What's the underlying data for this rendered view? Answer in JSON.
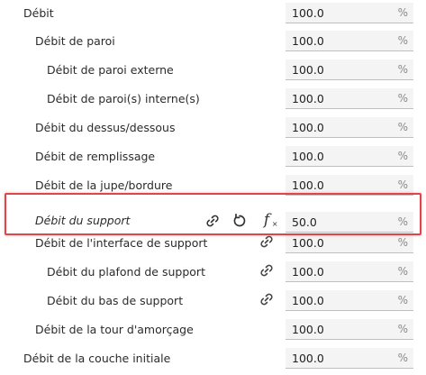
{
  "settings": [
    {
      "label": "Débit",
      "value": "100.0",
      "unit": "%"
    },
    {
      "label": "Débit de paroi",
      "value": "100.0",
      "unit": "%"
    },
    {
      "label": "Débit de paroi externe",
      "value": "100.0",
      "unit": "%"
    },
    {
      "label": "Débit de paroi(s) interne(s)",
      "value": "100.0",
      "unit": "%"
    },
    {
      "label": "Débit du dessus/dessous",
      "value": "100.0",
      "unit": "%"
    },
    {
      "label": "Débit de remplissage",
      "value": "100.0",
      "unit": "%"
    },
    {
      "label": "Débit de la jupe/bordure",
      "value": "100.0",
      "unit": "%"
    },
    {
      "label": "Débit du support",
      "value": "50.0",
      "unit": "%"
    },
    {
      "label": "Débit de l'interface de support",
      "value": "100.0",
      "unit": "%"
    },
    {
      "label": "Débit du plafond de support",
      "value": "100.0",
      "unit": "%"
    },
    {
      "label": "Débit du bas de support",
      "value": "100.0",
      "unit": "%"
    },
    {
      "label": "Débit de la tour d'amorçage",
      "value": "100.0",
      "unit": "%"
    },
    {
      "label": "Débit de la couche initiale",
      "value": "100.0",
      "unit": "%"
    }
  ],
  "icons": {
    "link": "link-icon",
    "reset": "reset-icon",
    "formula": "formula-icon"
  },
  "colors": {
    "highlight": "#e0454a"
  }
}
